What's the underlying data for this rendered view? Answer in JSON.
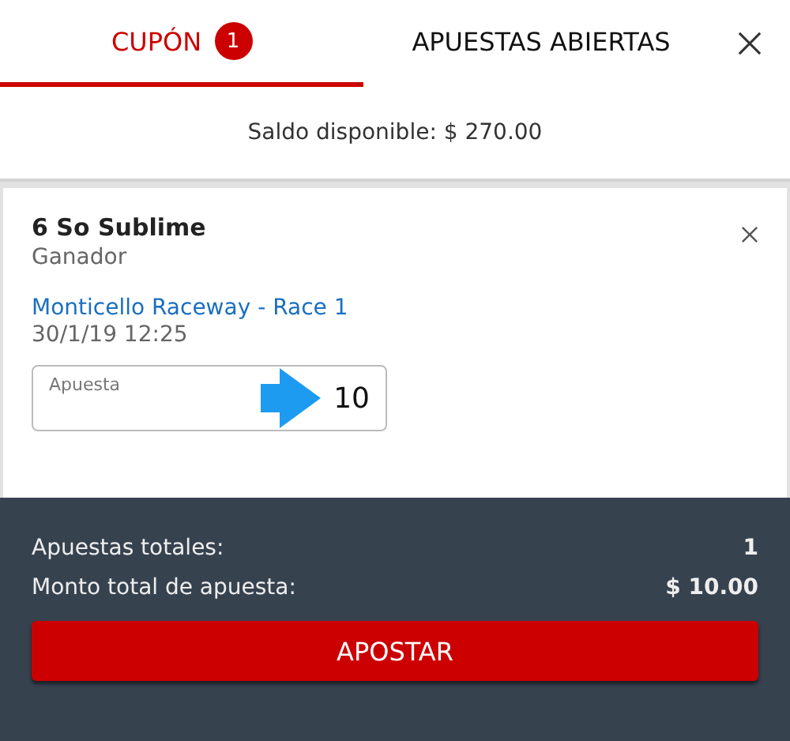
{
  "tabs": [
    {
      "label": "CUPÓN",
      "badge": "1",
      "selected": true
    },
    {
      "label": "APUESTAS ABIERTAS",
      "selected": false
    }
  ],
  "balance": "Saldo disponible: $ 270.00",
  "bet": {
    "selection": "6 So Sublime",
    "market": "Ganador",
    "event": "Monticello Raceway - Race 1",
    "datetime": "30/1/19 12:25",
    "stake": {
      "label": "Apuesta",
      "value": "10"
    }
  },
  "summary": [
    {
      "label": "Apuestas totales:",
      "value": "1"
    },
    {
      "label": "Monto total de apuesta:",
      "value": "$ 10.00"
    }
  ],
  "submit": "APOSTAR"
}
